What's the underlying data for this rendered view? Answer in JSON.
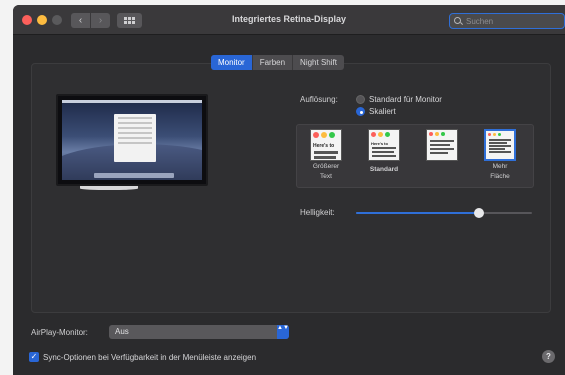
{
  "window": {
    "title": "Integriertes Retina-Display"
  },
  "nav": {
    "back_glyph": "‹",
    "forward_glyph": "›"
  },
  "search": {
    "placeholder": "Suchen",
    "value": ""
  },
  "tabs": [
    {
      "label": "Monitor",
      "active": true
    },
    {
      "label": "Farben",
      "active": false
    },
    {
      "label": "Night Shift",
      "active": false
    }
  ],
  "resolution": {
    "label": "Auflösung:",
    "options": [
      {
        "label": "Standard für Monitor",
        "selected": false
      },
      {
        "label": "Skaliert",
        "selected": true
      }
    ]
  },
  "scaling": {
    "thumb_text": "Here's to",
    "options": [
      {
        "caption_line1": "Größerer",
        "caption_line2": "Text",
        "selected": false
      },
      {
        "caption_line1": "Standard",
        "caption_line2": "",
        "selected": false
      },
      {
        "caption_line1": "",
        "caption_line2": "",
        "selected": false
      },
      {
        "caption_line1": "Mehr",
        "caption_line2": "Fläche",
        "selected": true
      }
    ]
  },
  "brightness": {
    "label": "Helligkeit:",
    "level": 0.7
  },
  "airplay": {
    "label": "AirPlay-Monitor:",
    "selected": "Aus",
    "arrows": "▲▼"
  },
  "sync": {
    "checked": true,
    "check_glyph": "✓",
    "label": "Sync-Optionen bei Verfügbarkeit in der Menüleiste anzeigen"
  },
  "help": {
    "glyph": "?"
  },
  "colors": {
    "accent": "#2966d6",
    "window_bg": "#2b2b2d",
    "close": "#fc605b",
    "minimize": "#fdbc40"
  }
}
